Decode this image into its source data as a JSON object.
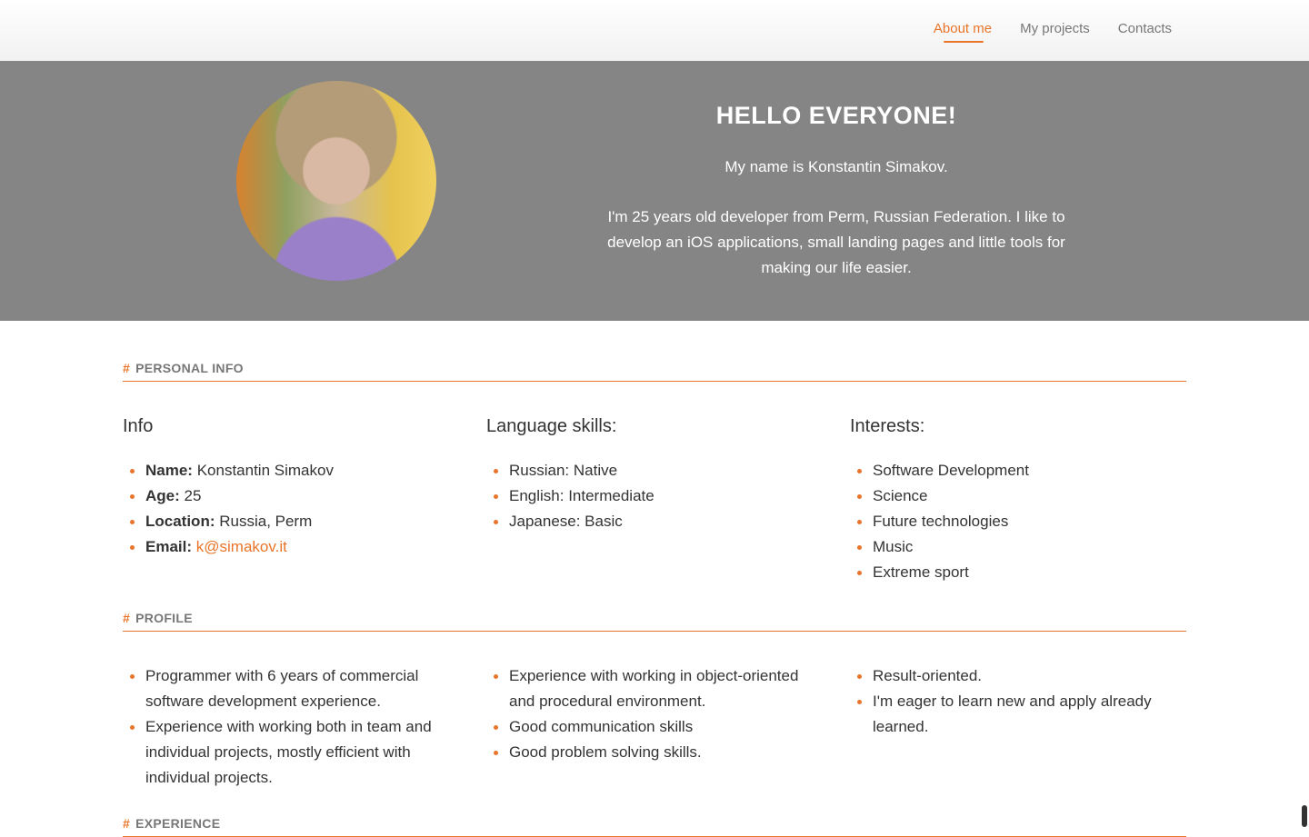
{
  "nav": {
    "items": [
      "About me",
      "My projects",
      "Contacts"
    ]
  },
  "hero": {
    "title": "HELLO EVERYONE!",
    "intro": "My name is Konstantin Simakov.",
    "description": "I'm 25 years old developer from Perm, Russian Federation. I like to develop an iOS applications, small landing pages and little tools for making our life easier."
  },
  "personal": {
    "section_title": "PERSONAL INFO",
    "info": {
      "heading": "Info",
      "name_label": "Name:",
      "name_value": "Konstantin Simakov",
      "age_label": "Age:",
      "age_value": "25",
      "location_label": "Location:",
      "location_value": "Russia, Perm",
      "email_label": "Email:",
      "email_value": "k@simakov.it"
    },
    "languages": {
      "heading": "Language skills:",
      "items": [
        "Russian: Native",
        "English: Intermediate",
        "Japanese: Basic"
      ]
    },
    "interests": {
      "heading": "Interests:",
      "items": [
        "Software Development",
        "Science",
        "Future technologies",
        "Music",
        "Extreme sport"
      ]
    }
  },
  "profile": {
    "section_title": "PROFILE",
    "col1": [
      "Programmer with 6 years of commercial software development experience.",
      "Experience with working both in team and individual projects, mostly efficient with individual projects."
    ],
    "col2": [
      "Experience with working in object-oriented and procedural environment.",
      "Good communication skills",
      "Good problem solving skills."
    ],
    "col3": [
      "Result-oriented.",
      "I'm eager to learn new and apply already learned."
    ]
  },
  "experience": {
    "section_title": "EXPERIENCE"
  },
  "section_hash": "#",
  "colors": {
    "accent": "#e8752a",
    "hero_bg": "#858585"
  }
}
